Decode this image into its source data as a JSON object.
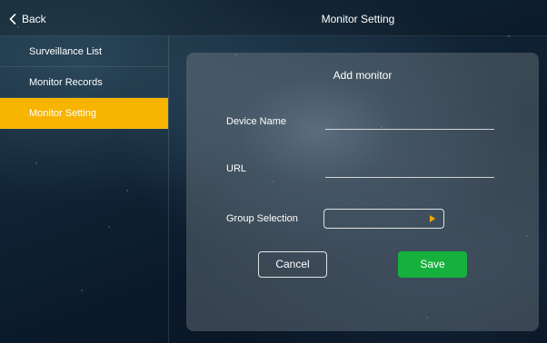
{
  "header": {
    "back_label": "Back",
    "title": "Monitor Setting"
  },
  "sidebar": {
    "items": [
      {
        "label": "Surveillance List"
      },
      {
        "label": "Monitor Records"
      },
      {
        "label": "Monitor Setting",
        "active": true
      }
    ],
    "active_color": "#f7b400"
  },
  "dialog": {
    "title": "Add monitor",
    "device_name": {
      "label": "Device Name",
      "value": ""
    },
    "url": {
      "label": "URL",
      "value": ""
    },
    "group_selection": {
      "label": "Group Selection",
      "value": ""
    },
    "cancel_label": "Cancel",
    "save_label": "Save",
    "save_color": "#16b13d",
    "caret_color": "#f2a900"
  },
  "icons": {
    "back": "chevron-left-icon",
    "dropdown": "caret-right-icon"
  }
}
